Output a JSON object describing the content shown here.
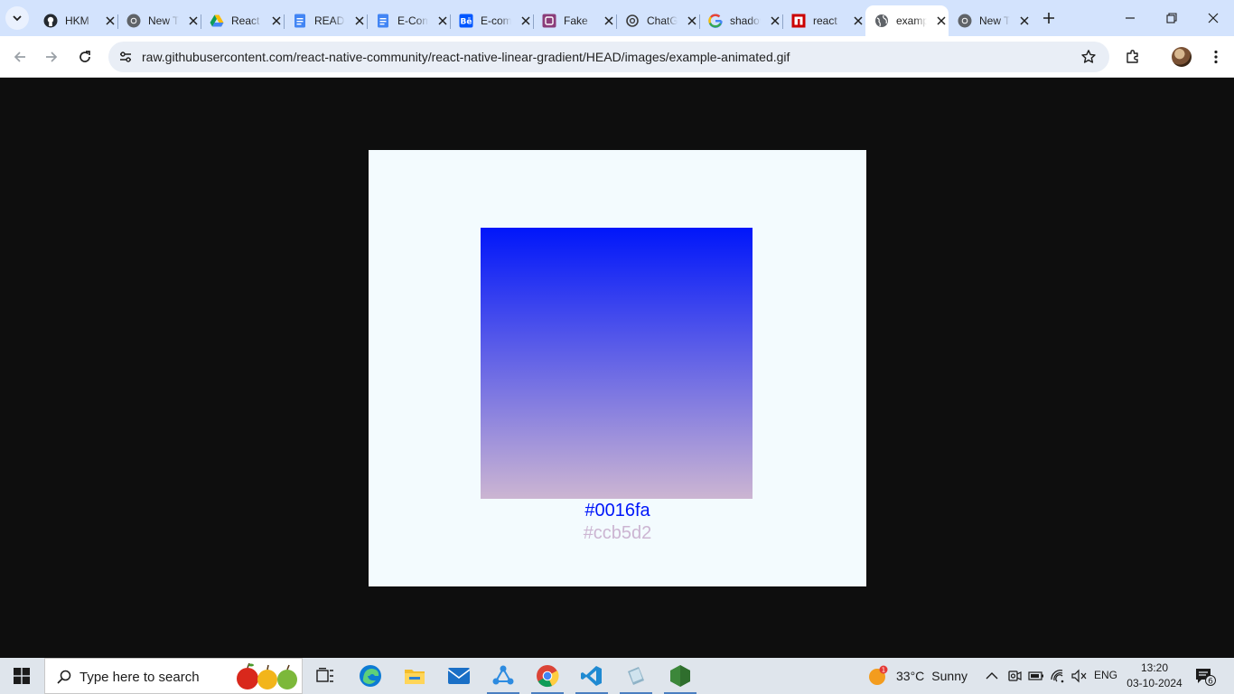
{
  "browser": {
    "tabs": [
      {
        "title": "HKM",
        "icon": "github-icon"
      },
      {
        "title": "New Tab",
        "icon": "chrome-icon"
      },
      {
        "title": "React",
        "icon": "google-drive-icon"
      },
      {
        "title": "README",
        "icon": "google-docs-icon"
      },
      {
        "title": "E-Commerce",
        "icon": "google-docs-icon"
      },
      {
        "title": "E-commerce",
        "icon": "behance-icon"
      },
      {
        "title": "Fake",
        "icon": "app-icon"
      },
      {
        "title": "ChatGPT",
        "icon": "openai-icon"
      },
      {
        "title": "shadow",
        "icon": "google-icon"
      },
      {
        "title": "react",
        "icon": "npm-icon"
      },
      {
        "title": "example-animated.gif",
        "icon": "globe-icon"
      },
      {
        "title": "New Tab",
        "icon": "chrome-icon"
      }
    ],
    "active_tab_index": 10,
    "address_bar": {
      "url": "raw.githubusercontent.com/react-native-community/react-native-linear-gradient/HEAD/images/example-animated.gif"
    }
  },
  "content": {
    "gradient_colors": {
      "top": "#0016fa",
      "bottom": "#ccb5d2"
    },
    "label_top": "#0016fa",
    "label_bottom": "#ccb5d2"
  },
  "taskbar": {
    "search_placeholder": "Type here to search",
    "apps": [
      "task-view-icon",
      "edge-icon",
      "file-explorer-icon",
      "mail-icon",
      "network-app-icon",
      "chrome-icon",
      "vscode-icon",
      "database-app-icon",
      "nodejs-icon"
    ],
    "weather": {
      "temperature": "33°C",
      "condition": "Sunny",
      "badge": "1"
    },
    "language": "ENG",
    "time": "13:20",
    "date": "03-10-2024",
    "notification_count": "6"
  }
}
